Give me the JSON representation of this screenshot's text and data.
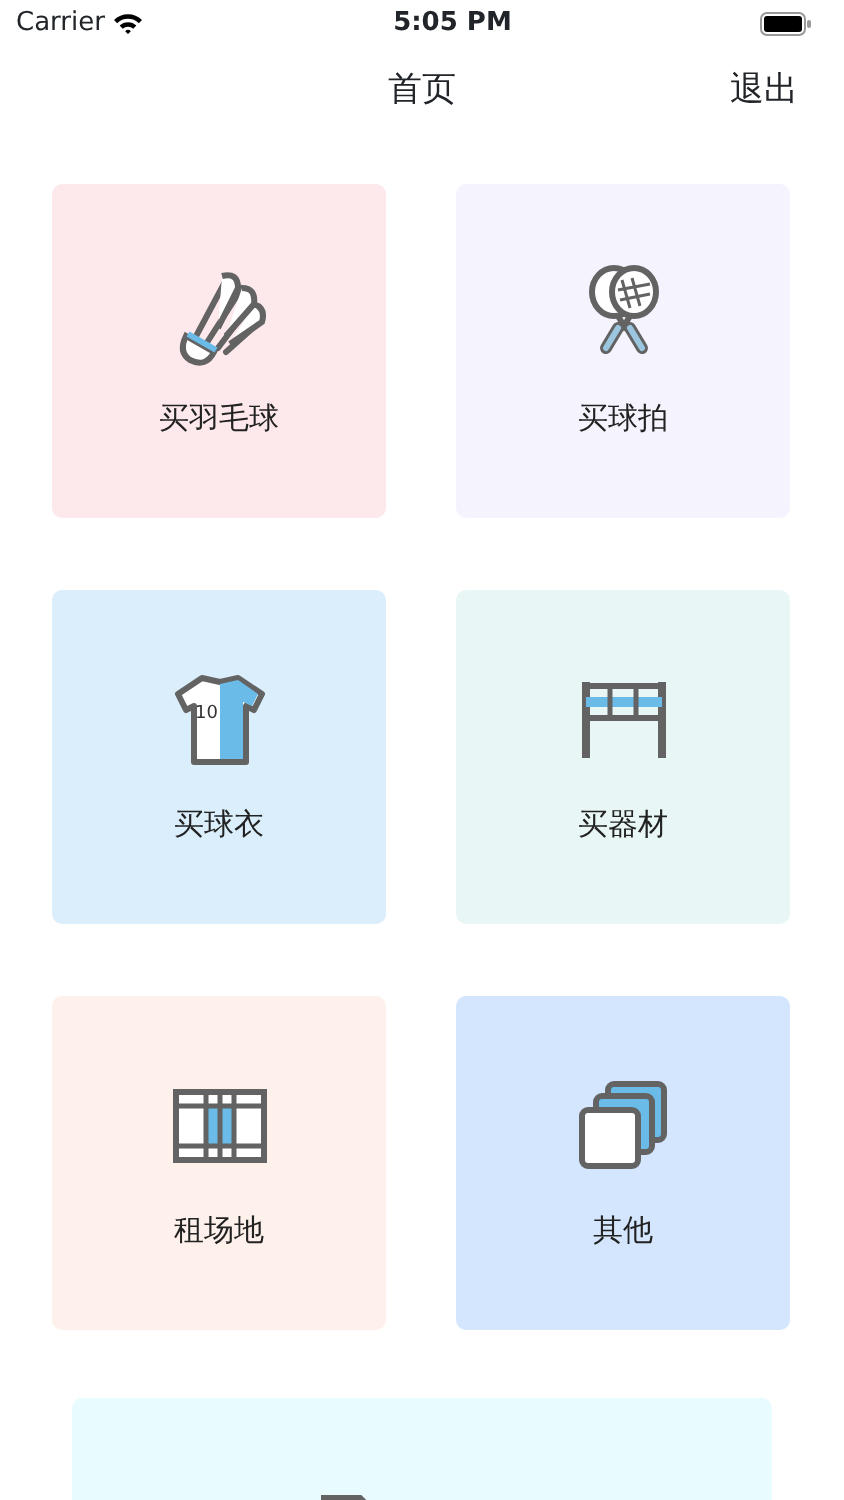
{
  "status_bar": {
    "carrier": "Carrier",
    "time": "5:05 PM"
  },
  "nav": {
    "title": "首页",
    "action": "退出"
  },
  "tiles": [
    {
      "label": "买羽毛球",
      "kind": "shuttlecock",
      "color": "#fde9ec"
    },
    {
      "label": "买球拍",
      "kind": "racket",
      "color": "#f5f4fe"
    },
    {
      "label": "买球衣",
      "kind": "shirt",
      "color": "#dbeefc",
      "number": "10"
    },
    {
      "label": "买器材",
      "kind": "net",
      "color": "#e8f7f6"
    },
    {
      "label": "租场地",
      "kind": "court",
      "color": "#fef1eb"
    },
    {
      "label": "其他",
      "kind": "stack",
      "color": "#d4e6fd"
    }
  ],
  "bottom_card": {
    "kind": "document",
    "color": "#e8fbfe"
  }
}
